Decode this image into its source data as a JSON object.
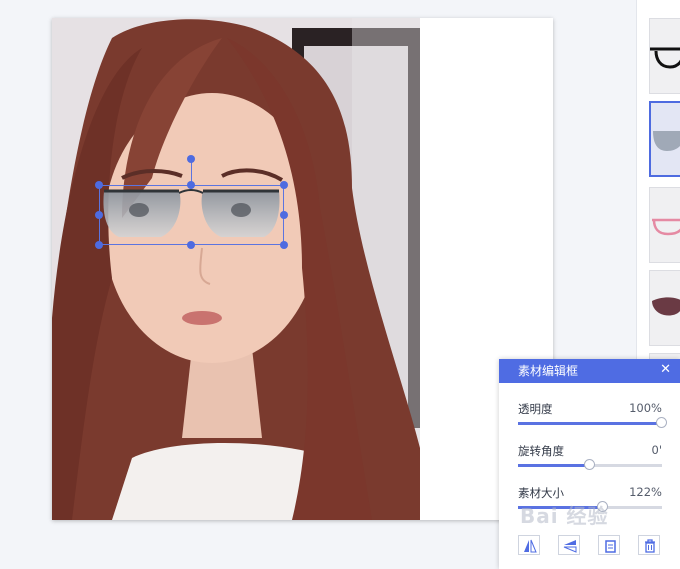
{
  "canvas": {
    "photo_label": "selfie-photo"
  },
  "panel": {
    "title": "素材编辑框",
    "close_glyph": "✕",
    "rows": [
      {
        "label": "透明度",
        "value": "100%",
        "level": 1.0
      },
      {
        "label": "旋转角度",
        "value": "0'",
        "level": 0.5
      },
      {
        "label": "素材大小",
        "value": "122%",
        "level": 0.59
      }
    ],
    "tools": [
      "flip-horizontal-icon",
      "flip-vertical-icon",
      "copy-icon",
      "delete-icon"
    ]
  },
  "sidebar": {
    "items": [
      {
        "name": "black-frame-glasses",
        "selected": false
      },
      {
        "name": "gradient-sunglasses",
        "selected": true
      },
      {
        "name": "pink-frame-glasses",
        "selected": false
      },
      {
        "name": "dark-red-sunglasses",
        "selected": false
      }
    ]
  },
  "watermark": "Bai 经验",
  "colors": {
    "accent": "#4f6ce3",
    "frame": "#5b74e0"
  }
}
